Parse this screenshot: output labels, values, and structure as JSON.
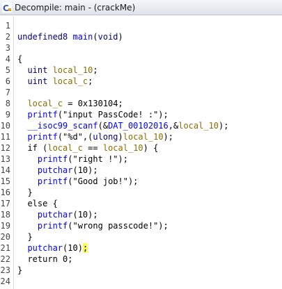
{
  "title": "Decompile: main - (crackMe)",
  "app_icon_letter": "C",
  "colors": {
    "keyword": "#000080",
    "function": "#0000ff",
    "variable": "#8a6d00",
    "highlight": "#ffff55"
  },
  "lines": [
    {
      "n": "1",
      "segs": []
    },
    {
      "n": "2",
      "segs": [
        {
          "t": "undefined8 ",
          "c": "kw"
        },
        {
          "t": "main",
          "c": "fn"
        },
        {
          "t": "(",
          "c": ""
        },
        {
          "t": "void",
          "c": "kw"
        },
        {
          "t": ")",
          "c": ""
        }
      ]
    },
    {
      "n": "3",
      "segs": []
    },
    {
      "n": "4",
      "segs": [
        {
          "t": "{",
          "c": ""
        }
      ]
    },
    {
      "n": "5",
      "segs": [
        {
          "t": "  uint ",
          "c": "kw"
        },
        {
          "t": "local_10",
          "c": "var"
        },
        {
          "t": ";",
          "c": ""
        }
      ]
    },
    {
      "n": "6",
      "segs": [
        {
          "t": "  uint ",
          "c": "kw"
        },
        {
          "t": "local_c",
          "c": "var"
        },
        {
          "t": ";",
          "c": ""
        }
      ]
    },
    {
      "n": "7",
      "segs": []
    },
    {
      "n": "8",
      "segs": [
        {
          "t": "  ",
          "c": ""
        },
        {
          "t": "local_c",
          "c": "var"
        },
        {
          "t": " = 0x130104;",
          "c": ""
        }
      ]
    },
    {
      "n": "9",
      "segs": [
        {
          "t": "  ",
          "c": ""
        },
        {
          "t": "printf",
          "c": "fn"
        },
        {
          "t": "(\"input PassCode! :\");",
          "c": ""
        }
      ]
    },
    {
      "n": "10",
      "segs": [
        {
          "t": "  ",
          "c": ""
        },
        {
          "t": "__isoc99_scanf",
          "c": "fn"
        },
        {
          "t": "(&",
          "c": ""
        },
        {
          "t": "DAT_00102016",
          "c": "glob"
        },
        {
          "t": ",&",
          "c": ""
        },
        {
          "t": "local_10",
          "c": "var"
        },
        {
          "t": ");",
          "c": ""
        }
      ]
    },
    {
      "n": "11",
      "segs": [
        {
          "t": "  ",
          "c": ""
        },
        {
          "t": "printf",
          "c": "fn"
        },
        {
          "t": "(\"%d\",(",
          "c": ""
        },
        {
          "t": "ulong",
          "c": "kw"
        },
        {
          "t": ")",
          "c": ""
        },
        {
          "t": "local_10",
          "c": "var"
        },
        {
          "t": ");",
          "c": ""
        }
      ]
    },
    {
      "n": "12",
      "segs": [
        {
          "t": "  if (",
          "c": ""
        },
        {
          "t": "local_c",
          "c": "var"
        },
        {
          "t": " == ",
          "c": ""
        },
        {
          "t": "local_10",
          "c": "var"
        },
        {
          "t": ") {",
          "c": ""
        }
      ]
    },
    {
      "n": "13",
      "segs": [
        {
          "t": "    ",
          "c": ""
        },
        {
          "t": "printf",
          "c": "fn"
        },
        {
          "t": "(\"right !\");",
          "c": ""
        }
      ]
    },
    {
      "n": "14",
      "segs": [
        {
          "t": "    ",
          "c": ""
        },
        {
          "t": "putchar",
          "c": "fn"
        },
        {
          "t": "(10);",
          "c": ""
        }
      ]
    },
    {
      "n": "15",
      "segs": [
        {
          "t": "    ",
          "c": ""
        },
        {
          "t": "printf",
          "c": "fn"
        },
        {
          "t": "(\"Good job!\");",
          "c": ""
        }
      ]
    },
    {
      "n": "16",
      "segs": [
        {
          "t": "  }",
          "c": ""
        }
      ]
    },
    {
      "n": "17",
      "segs": [
        {
          "t": "  else {",
          "c": ""
        }
      ]
    },
    {
      "n": "18",
      "segs": [
        {
          "t": "    ",
          "c": ""
        },
        {
          "t": "putchar",
          "c": "fn"
        },
        {
          "t": "(10);",
          "c": ""
        }
      ]
    },
    {
      "n": "19",
      "segs": [
        {
          "t": "    ",
          "c": ""
        },
        {
          "t": "printf",
          "c": "fn"
        },
        {
          "t": "(\"wrong passcode!\");",
          "c": ""
        }
      ]
    },
    {
      "n": "20",
      "segs": [
        {
          "t": "  }",
          "c": ""
        }
      ]
    },
    {
      "n": "21",
      "segs": [
        {
          "t": "  ",
          "c": ""
        },
        {
          "t": "putchar",
          "c": "fn"
        },
        {
          "t": "(10)",
          "c": ""
        },
        {
          "t": ";",
          "c": "hl"
        }
      ]
    },
    {
      "n": "22",
      "segs": [
        {
          "t": "  return 0;",
          "c": ""
        }
      ]
    },
    {
      "n": "23",
      "segs": [
        {
          "t": "}",
          "c": ""
        }
      ]
    },
    {
      "n": "24",
      "segs": []
    }
  ]
}
